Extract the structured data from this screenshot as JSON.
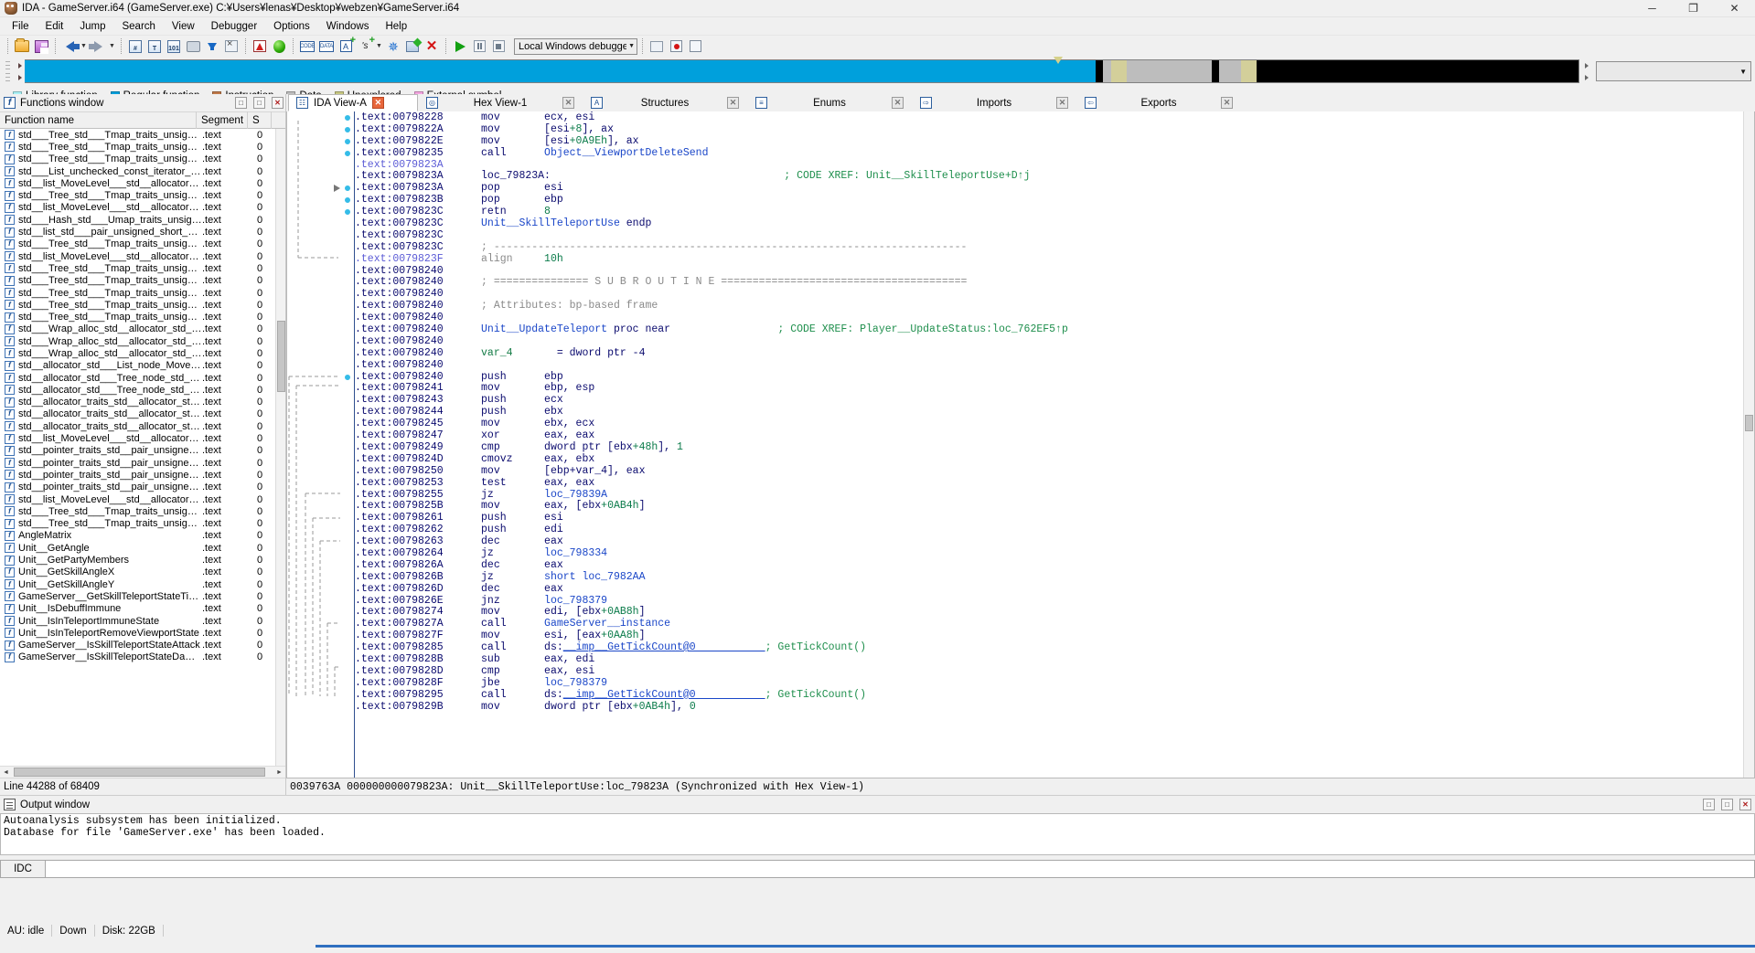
{
  "window": {
    "title": "IDA - GameServer.i64 (GameServer.exe) C:¥Users¥lenas¥Desktop¥webzen¥GameServer.i64",
    "logo_icon": "ida-app-icon",
    "minimize_label": "─",
    "maximize_label": "❐",
    "close_label": "✕"
  },
  "menubar": {
    "items": [
      {
        "label": "File"
      },
      {
        "label": "Edit"
      },
      {
        "label": "Jump"
      },
      {
        "label": "Search"
      },
      {
        "label": "View"
      },
      {
        "label": "Debugger"
      },
      {
        "label": "Options"
      },
      {
        "label": "Windows"
      },
      {
        "label": "Help"
      }
    ]
  },
  "toolbar": {
    "debugger_selector_value": "Local Windows debugger",
    "debugger_selector_arrow": "▼",
    "buttons": [
      {
        "name": "open-file-button",
        "icon": "folder-open-icon"
      },
      {
        "name": "save-file-button",
        "icon": "floppy-save-icon"
      },
      {
        "name": "navigate-back-button",
        "icon": "arrow-left-icon"
      },
      {
        "name": "navigate-back-dropdown",
        "icon": "chevron-down-icon"
      },
      {
        "name": "navigate-forward-button",
        "icon": "arrow-right-icon"
      },
      {
        "name": "navigate-forward-dropdown",
        "icon": "chevron-down-icon"
      },
      {
        "name": "jump-to-address-button",
        "icon": "binoculars-hash-icon"
      },
      {
        "name": "jump-to-text-button",
        "icon": "binoculars-text-icon"
      },
      {
        "name": "jump-to-binary-button",
        "icon": "binoculars-binary-icon"
      },
      {
        "name": "jump-to-xref-button",
        "icon": "hand-pointer-icon"
      },
      {
        "name": "jump-entry-point-button",
        "icon": "blue-down-arrow-icon"
      },
      {
        "name": "no-graph-button",
        "icon": "graph-disabled-icon"
      },
      {
        "name": "problems-button",
        "icon": "warning-triangle-icon"
      },
      {
        "name": "run-to-cursor-button",
        "icon": "green-sphere-icon"
      },
      {
        "name": "make-code-button",
        "icon": "make-code-icon"
      },
      {
        "name": "make-data-button",
        "icon": "make-data-icon"
      },
      {
        "name": "make-ascii-button",
        "icon": "make-ascii-icon"
      },
      {
        "name": "make-struct-button",
        "icon": "make-struct-icon"
      },
      {
        "name": "make-struct-dropdown",
        "icon": "chevron-down-icon"
      },
      {
        "name": "make-array-button",
        "icon": "snowflake-icon"
      },
      {
        "name": "edit-function-button",
        "icon": "pencil-edit-icon"
      },
      {
        "name": "undefine-button",
        "icon": "red-x-icon"
      },
      {
        "name": "start-process-button",
        "icon": "play-triangle-icon"
      },
      {
        "name": "pause-process-button",
        "icon": "pause-icon"
      },
      {
        "name": "terminate-process-button",
        "icon": "stop-icon"
      },
      {
        "name": "recent-scripts-button",
        "icon": "recent-scripts-icon"
      },
      {
        "name": "breakpoints-button",
        "icon": "breakpoint-icon"
      },
      {
        "name": "clear-breakpoints-button",
        "icon": "breakpoint-disabled-icon"
      }
    ]
  },
  "navband": {
    "cursor_left_pct": 66.2,
    "right_dropdown_arrow": "▼",
    "segments": [
      {
        "color": "#00a0dc",
        "width_pct": 68.9
      },
      {
        "color": "#000000",
        "width_pct": 0.5
      },
      {
        "color": "#bdbdbd",
        "width_pct": 0.5
      },
      {
        "color": "#d3cf9a",
        "width_pct": 1.0
      },
      {
        "color": "#bdbdbd",
        "width_pct": 5.5
      },
      {
        "color": "#000000",
        "width_pct": 0.5
      },
      {
        "color": "#bdbdbd",
        "width_pct": 1.4
      },
      {
        "color": "#d3cf9a",
        "width_pct": 1.0
      },
      {
        "color": "#000000",
        "width_pct": 20.7
      }
    ]
  },
  "legend": {
    "items": [
      {
        "label": "Library function",
        "color": "#aaf0f5"
      },
      {
        "label": "Regular function",
        "color": "#00a0dc"
      },
      {
        "label": "Instruction",
        "color": "#c07a4a"
      },
      {
        "label": "Data",
        "color": "#bdbdbd"
      },
      {
        "label": "Unexplored",
        "color": "#c8c882"
      },
      {
        "label": "External symbol",
        "color": "#f4a6e0"
      }
    ]
  },
  "functions_window": {
    "title": "Functions window",
    "title_icon": "function-f-icon",
    "buttons": {
      "restore": "□",
      "maximize": "□",
      "close": "✕"
    },
    "columns": [
      "Function name",
      "Segment",
      "S"
    ],
    "rows": [
      {
        "name": "std___Tree_std___Tmap_traits_unsigned···",
        "segment": ".text",
        "s": "0"
      },
      {
        "name": "std___Tree_std___Tmap_traits_unsigned···",
        "segment": ".text",
        "s": "0"
      },
      {
        "name": "std___Tree_std___Tmap_traits_unsigned···",
        "segment": ".text",
        "s": "0"
      },
      {
        "name": "std___List_unchecked_const_iterator_std···",
        "segment": ".text",
        "s": "0"
      },
      {
        "name": "std__list_MoveLevel___std__allocator_M···",
        "segment": ".text",
        "s": "0"
      },
      {
        "name": "std___Tree_std___Tmap_traits_unsigned···",
        "segment": ".text",
        "s": "0"
      },
      {
        "name": "std__list_MoveLevel___std__allocator_M···",
        "segment": ".text",
        "s": "0"
      },
      {
        "name": "std___Hash_std___Umap_traits_unsigned···",
        "segment": ".text",
        "s": "0"
      },
      {
        "name": "std__list_std___pair_unsigned_short_const···",
        "segment": ".text",
        "s": "0"
      },
      {
        "name": "std___Tree_std___Tmap_traits_unsigned···",
        "segment": ".text",
        "s": "0"
      },
      {
        "name": "std__list_MoveLevel___std__allocator_M···",
        "segment": ".text",
        "s": "0"
      },
      {
        "name": "std___Tree_std___Tmap_traits_unsigned···",
        "segment": ".text",
        "s": "0"
      },
      {
        "name": "std___Tree_std___Tmap_traits_unsigned···",
        "segment": ".text",
        "s": "0"
      },
      {
        "name": "std___Tree_std___Tmap_traits_unsigned···",
        "segment": ".text",
        "s": "0"
      },
      {
        "name": "std___Tree_std___Tmap_traits_unsigned···",
        "segment": ".text",
        "s": "0"
      },
      {
        "name": "std___Tree_std___Tmap_traits_unsigned···",
        "segment": ".text",
        "s": "0"
      },
      {
        "name": "std___Wrap_alloc_std__allocator_std___Li···",
        "segment": ".text",
        "s": "0"
      },
      {
        "name": "std___Wrap_alloc_std__allocator_std___T···",
        "segment": ".text",
        "s": "0"
      },
      {
        "name": "std___Wrap_alloc_std__allocator_std___T···",
        "segment": ".text",
        "s": "0"
      },
      {
        "name": "std__allocator_std___List_node_MoveLev···",
        "segment": ".text",
        "s": "0"
      },
      {
        "name": "std__allocator_std___Tree_node_std___pai···",
        "segment": ".text",
        "s": "0"
      },
      {
        "name": "std__allocator_std___Tree_node_std___pai···",
        "segment": ".text",
        "s": "0"
      },
      {
        "name": "std__allocator_traits_std__allocator_std···",
        "segment": ".text",
        "s": "0"
      },
      {
        "name": "std__allocator_traits_std__allocator_std···",
        "segment": ".text",
        "s": "0"
      },
      {
        "name": "std__allocator_traits_std__allocator_std···",
        "segment": ".text",
        "s": "0"
      },
      {
        "name": "std__list_MoveLevel___std__allocator_M···",
        "segment": ".text",
        "s": "0"
      },
      {
        "name": "std__pointer_traits_std__pair_unsigned_c···",
        "segment": ".text",
        "s": "0"
      },
      {
        "name": "std__pointer_traits_std__pair_unsigned_s···",
        "segment": ".text",
        "s": "0"
      },
      {
        "name": "std__pointer_traits_std__pair_unsigned_c···",
        "segment": ".text",
        "s": "0"
      },
      {
        "name": "std__pointer_traits_std__pair_unsigned_s···",
        "segment": ".text",
        "s": "0"
      },
      {
        "name": "std__list_MoveLevel___std__allocator_M···",
        "segment": ".text",
        "s": "0"
      },
      {
        "name": "std___Tree_std___Tmap_traits_unsigned···",
        "segment": ".text",
        "s": "0"
      },
      {
        "name": "std___Tree_std___Tmap_traits_unsigned···",
        "segment": ".text",
        "s": "0"
      },
      {
        "name": "AngleMatrix",
        "segment": ".text",
        "s": "0"
      },
      {
        "name": "Unit__GetAngle",
        "segment": ".text",
        "s": "0"
      },
      {
        "name": "Unit__GetPartyMembers",
        "segment": ".text",
        "s": "0"
      },
      {
        "name": "Unit__GetSkillAngleX",
        "segment": ".text",
        "s": "0"
      },
      {
        "name": "Unit__GetSkillAngleY",
        "segment": ".text",
        "s": "0"
      },
      {
        "name": "GameServer__GetSkillTeleportStateTime",
        "segment": ".text",
        "s": "0"
      },
      {
        "name": "Unit__IsDebuffImmune",
        "segment": ".text",
        "s": "0"
      },
      {
        "name": "Unit__IsInTeleportImmuneState",
        "segment": ".text",
        "s": "0"
      },
      {
        "name": "Unit__IsInTeleportRemoveViewportState",
        "segment": ".text",
        "s": "0"
      },
      {
        "name": "GameServer__IsSkillTeleportStateAttack",
        "segment": ".text",
        "s": "0"
      },
      {
        "name": "GameServer__IsSkillTeleportStateDamag···",
        "segment": ".text",
        "s": "0"
      }
    ],
    "hscroll_left_arrow": "◄",
    "hscroll_right_arrow": "►",
    "status": "Line 44288 of 68409"
  },
  "disassembly": {
    "tabs": [
      {
        "label": "IDA View-A",
        "icon": "ida-view-icon",
        "close": "✕",
        "active": true
      },
      {
        "label": "Hex View-1",
        "icon": "hex-view-icon",
        "close": "✕",
        "active": false
      },
      {
        "label": "Structures",
        "icon": "structures-icon",
        "close": "✕",
        "active": false
      },
      {
        "label": "Enums",
        "icon": "enums-icon",
        "close": "✕",
        "active": false
      },
      {
        "label": "Imports",
        "icon": "imports-icon",
        "close": "✕",
        "active": false
      },
      {
        "label": "Exports",
        "icon": "exports-icon",
        "close": "✕",
        "active": false
      }
    ],
    "status": "0039763A 000000000079823A: Unit__SkillTeleportUse:loc_79823A (Synchronized with Hex View-1)",
    "lines": [
      {
        "addr": ".text:00798228",
        "mnem": "mov",
        "ops": "ecx, esi",
        "dot": true
      },
      {
        "addr": ".text:0079822A",
        "mnem": "mov",
        "ops": "[esi+8], ax",
        "dot": true
      },
      {
        "addr": ".text:0079822E",
        "mnem": "mov",
        "ops": "[esi+0A9Eh], ax",
        "dot": true
      },
      {
        "addr": ".text:00798235",
        "mnem": "call",
        "ops": "Object__ViewportDeleteSend",
        "op_kind": "fn",
        "dot": true
      },
      {
        "addr": ".text:0079823A",
        "dim": true
      },
      {
        "addr": ".text:0079823A",
        "label": "loc_79823A:",
        "comment": "; CODE XREF: Unit__SkillTeleportUse+D↑j"
      },
      {
        "addr": ".text:0079823A",
        "mnem": "pop",
        "ops": "esi",
        "dot": true,
        "arrow_in": true
      },
      {
        "addr": ".text:0079823B",
        "mnem": "pop",
        "ops": "ebp",
        "dot": true
      },
      {
        "addr": ".text:0079823C",
        "mnem": "retn",
        "ops": "8",
        "op_kind": "num",
        "dot": true
      },
      {
        "addr": ".text:0079823C",
        "endp": "Unit__SkillTeleportUse endp"
      },
      {
        "addr": ".text:0079823C"
      },
      {
        "addr": ".text:0079823C",
        "rule": "; ---------------------------------------------------------------------------"
      },
      {
        "addr": ".text:0079823F",
        "dim": true,
        "mnem": "align",
        "ops": "10h",
        "gray": true
      },
      {
        "addr": ".text:00798240"
      },
      {
        "addr": ".text:00798240",
        "rule": "; =============== S U B R O U T I N E ======================================="
      },
      {
        "addr": ".text:00798240"
      },
      {
        "addr": ".text:00798240",
        "attrs": "; Attributes: bp-based frame"
      },
      {
        "addr": ".text:00798240"
      },
      {
        "addr": ".text:00798240",
        "proc": "Unit__UpdateTeleport proc near",
        "comment": "; CODE XREF: Player__UpdateStatus:loc_762EF5↑p"
      },
      {
        "addr": ".text:00798240"
      },
      {
        "addr": ".text:00798240",
        "vardef": "var_4",
        "vardef_rhs": "= dword ptr -4"
      },
      {
        "addr": ".text:00798240"
      },
      {
        "addr": ".text:00798240",
        "mnem": "push",
        "ops": "ebp",
        "dot": true
      },
      {
        "addr": ".text:00798241",
        "mnem": "mov",
        "ops": "ebp, esp"
      },
      {
        "addr": ".text:00798243",
        "mnem": "push",
        "ops": "ecx"
      },
      {
        "addr": ".text:00798244",
        "mnem": "push",
        "ops": "ebx"
      },
      {
        "addr": ".text:00798245",
        "mnem": "mov",
        "ops": "ebx, ecx"
      },
      {
        "addr": ".text:00798247",
        "mnem": "xor",
        "ops": "eax, eax"
      },
      {
        "addr": ".text:00798249",
        "mnem": "cmp",
        "ops": "dword ptr [ebx+48h], 1"
      },
      {
        "addr": ".text:0079824D",
        "mnem": "cmovz",
        "ops": "eax, ebx"
      },
      {
        "addr": ".text:00798250",
        "mnem": "mov",
        "ops": "[ebp+var_4], eax"
      },
      {
        "addr": ".text:00798253",
        "mnem": "test",
        "ops": "eax, eax"
      },
      {
        "addr": ".text:00798255",
        "mnem": "jz",
        "ops": "loc_79839A",
        "op_kind": "fn"
      },
      {
        "addr": ".text:0079825B",
        "mnem": "mov",
        "ops": "eax, [ebx+0AB4h]"
      },
      {
        "addr": ".text:00798261",
        "mnem": "push",
        "ops": "esi"
      },
      {
        "addr": ".text:00798262",
        "mnem": "push",
        "ops": "edi"
      },
      {
        "addr": ".text:00798263",
        "mnem": "dec",
        "ops": "eax"
      },
      {
        "addr": ".text:00798264",
        "mnem": "jz",
        "ops": "loc_798334",
        "op_kind": "fn"
      },
      {
        "addr": ".text:0079826A",
        "mnem": "dec",
        "ops": "eax"
      },
      {
        "addr": ".text:0079826B",
        "mnem": "jz",
        "ops": "short loc_7982AA",
        "op_kind": "fn"
      },
      {
        "addr": ".text:0079826D",
        "mnem": "dec",
        "ops": "eax"
      },
      {
        "addr": ".text:0079826E",
        "mnem": "jnz",
        "ops": "loc_798379",
        "op_kind": "fn"
      },
      {
        "addr": ".text:00798274",
        "mnem": "mov",
        "ops": "edi, [ebx+0AB8h]"
      },
      {
        "addr": ".text:0079827A",
        "mnem": "call",
        "ops": "GameServer__instance",
        "op_kind": "fn"
      },
      {
        "addr": ".text:0079827F",
        "mnem": "mov",
        "ops": "esi, [eax+0AA8h]"
      },
      {
        "addr": ".text:00798285",
        "mnem": "call",
        "ops": "ds:__imp__GetTickCount@0",
        "op_kind": "import",
        "comment": "; GetTickCount()"
      },
      {
        "addr": ".text:0079828B",
        "mnem": "sub",
        "ops": "eax, edi"
      },
      {
        "addr": ".text:0079828D",
        "mnem": "cmp",
        "ops": "eax, esi"
      },
      {
        "addr": ".text:0079828F",
        "mnem": "jbe",
        "ops": "loc_798379",
        "op_kind": "fn"
      },
      {
        "addr": ".text:00798295",
        "mnem": "call",
        "ops": "ds:__imp__GetTickCount@0",
        "op_kind": "import",
        "comment": "; GetTickCount()"
      },
      {
        "addr": ".text:0079829B",
        "mnem": "mov",
        "ops": "dword ptr [ebx+0AB4h], 0"
      }
    ]
  },
  "output_window": {
    "title": "Output window",
    "title_icon": "output-lines-icon",
    "buttons": {
      "restore": "□",
      "maximize": "□",
      "close": "✕"
    },
    "lines": [
      "Autoanalysis subsystem has been initialized.",
      "Database for file 'GameServer.exe' has been loaded."
    ],
    "idc_button": "IDC",
    "idc_value": "",
    "idc_placeholder": ""
  },
  "statusbar": {
    "cells": [
      "AU: idle",
      "Down",
      "Disk: 22GB"
    ]
  }
}
